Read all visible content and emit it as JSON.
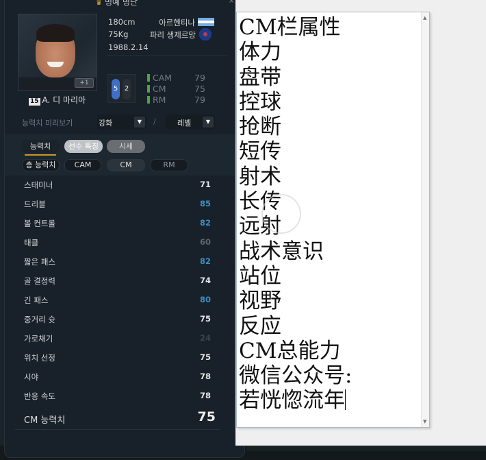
{
  "panel": {
    "title": "명예 명단",
    "close": "×",
    "player": {
      "number": "15",
      "name": "A. 디 마리아",
      "plus_badge": "+1",
      "height": "180cm",
      "weight": "75Kg",
      "birth": "1988.2.14",
      "nation": "아르헨티나",
      "club": "파리 생제르망",
      "foot_left": "5",
      "foot_right": "2",
      "positions": [
        {
          "name": "CAM",
          "value": "79"
        },
        {
          "name": "CM",
          "value": "75"
        },
        {
          "name": "RM",
          "value": "79"
        }
      ]
    },
    "preview": {
      "label": "능력치 미리보기",
      "upgrade_select": "강화",
      "level_select": "레벨",
      "separator": "/"
    },
    "tabs": [
      {
        "label": "능력치"
      },
      {
        "label": "선수 특징"
      },
      {
        "label": "시세"
      }
    ],
    "subtabs": [
      {
        "label": "총 능력치"
      },
      {
        "label": "CAM"
      },
      {
        "label": "CM"
      },
      {
        "label": "RM"
      }
    ],
    "stats": [
      {
        "name": "스태미너",
        "value": "71",
        "color": "#e6e6e6"
      },
      {
        "name": "드리블",
        "value": "85",
        "color": "#3a8ec4"
      },
      {
        "name": "볼 컨트롤",
        "value": "82",
        "color": "#3a8ec4"
      },
      {
        "name": "태클",
        "value": "60",
        "color": "#5c6670"
      },
      {
        "name": "짧은 패스",
        "value": "82",
        "color": "#3a8ec4"
      },
      {
        "name": "골 결정력",
        "value": "74",
        "color": "#e6e6e6"
      },
      {
        "name": "긴 패스",
        "value": "80",
        "color": "#3a8ec4"
      },
      {
        "name": "중거리 슛",
        "value": "75",
        "color": "#e6e6e6"
      },
      {
        "name": "가로채기",
        "value": "24",
        "color": "#3a444c"
      },
      {
        "name": "위치 선정",
        "value": "75",
        "color": "#e6e6e6"
      },
      {
        "name": "시야",
        "value": "78",
        "color": "#e6e6e6"
      },
      {
        "name": "반응 속도",
        "value": "78",
        "color": "#e6e6e6"
      }
    ],
    "total": {
      "label": "CM 능력치",
      "value": "75"
    }
  },
  "editor": {
    "lines": [
      "CM栏属性",
      "体力",
      "盘带",
      "控球",
      "抢断",
      "短传",
      "射术",
      "长传",
      "远射",
      "战术意识",
      "站位",
      "视野",
      "反应",
      "CM总能力",
      "微信公众号:",
      "若恍惚流年"
    ]
  }
}
